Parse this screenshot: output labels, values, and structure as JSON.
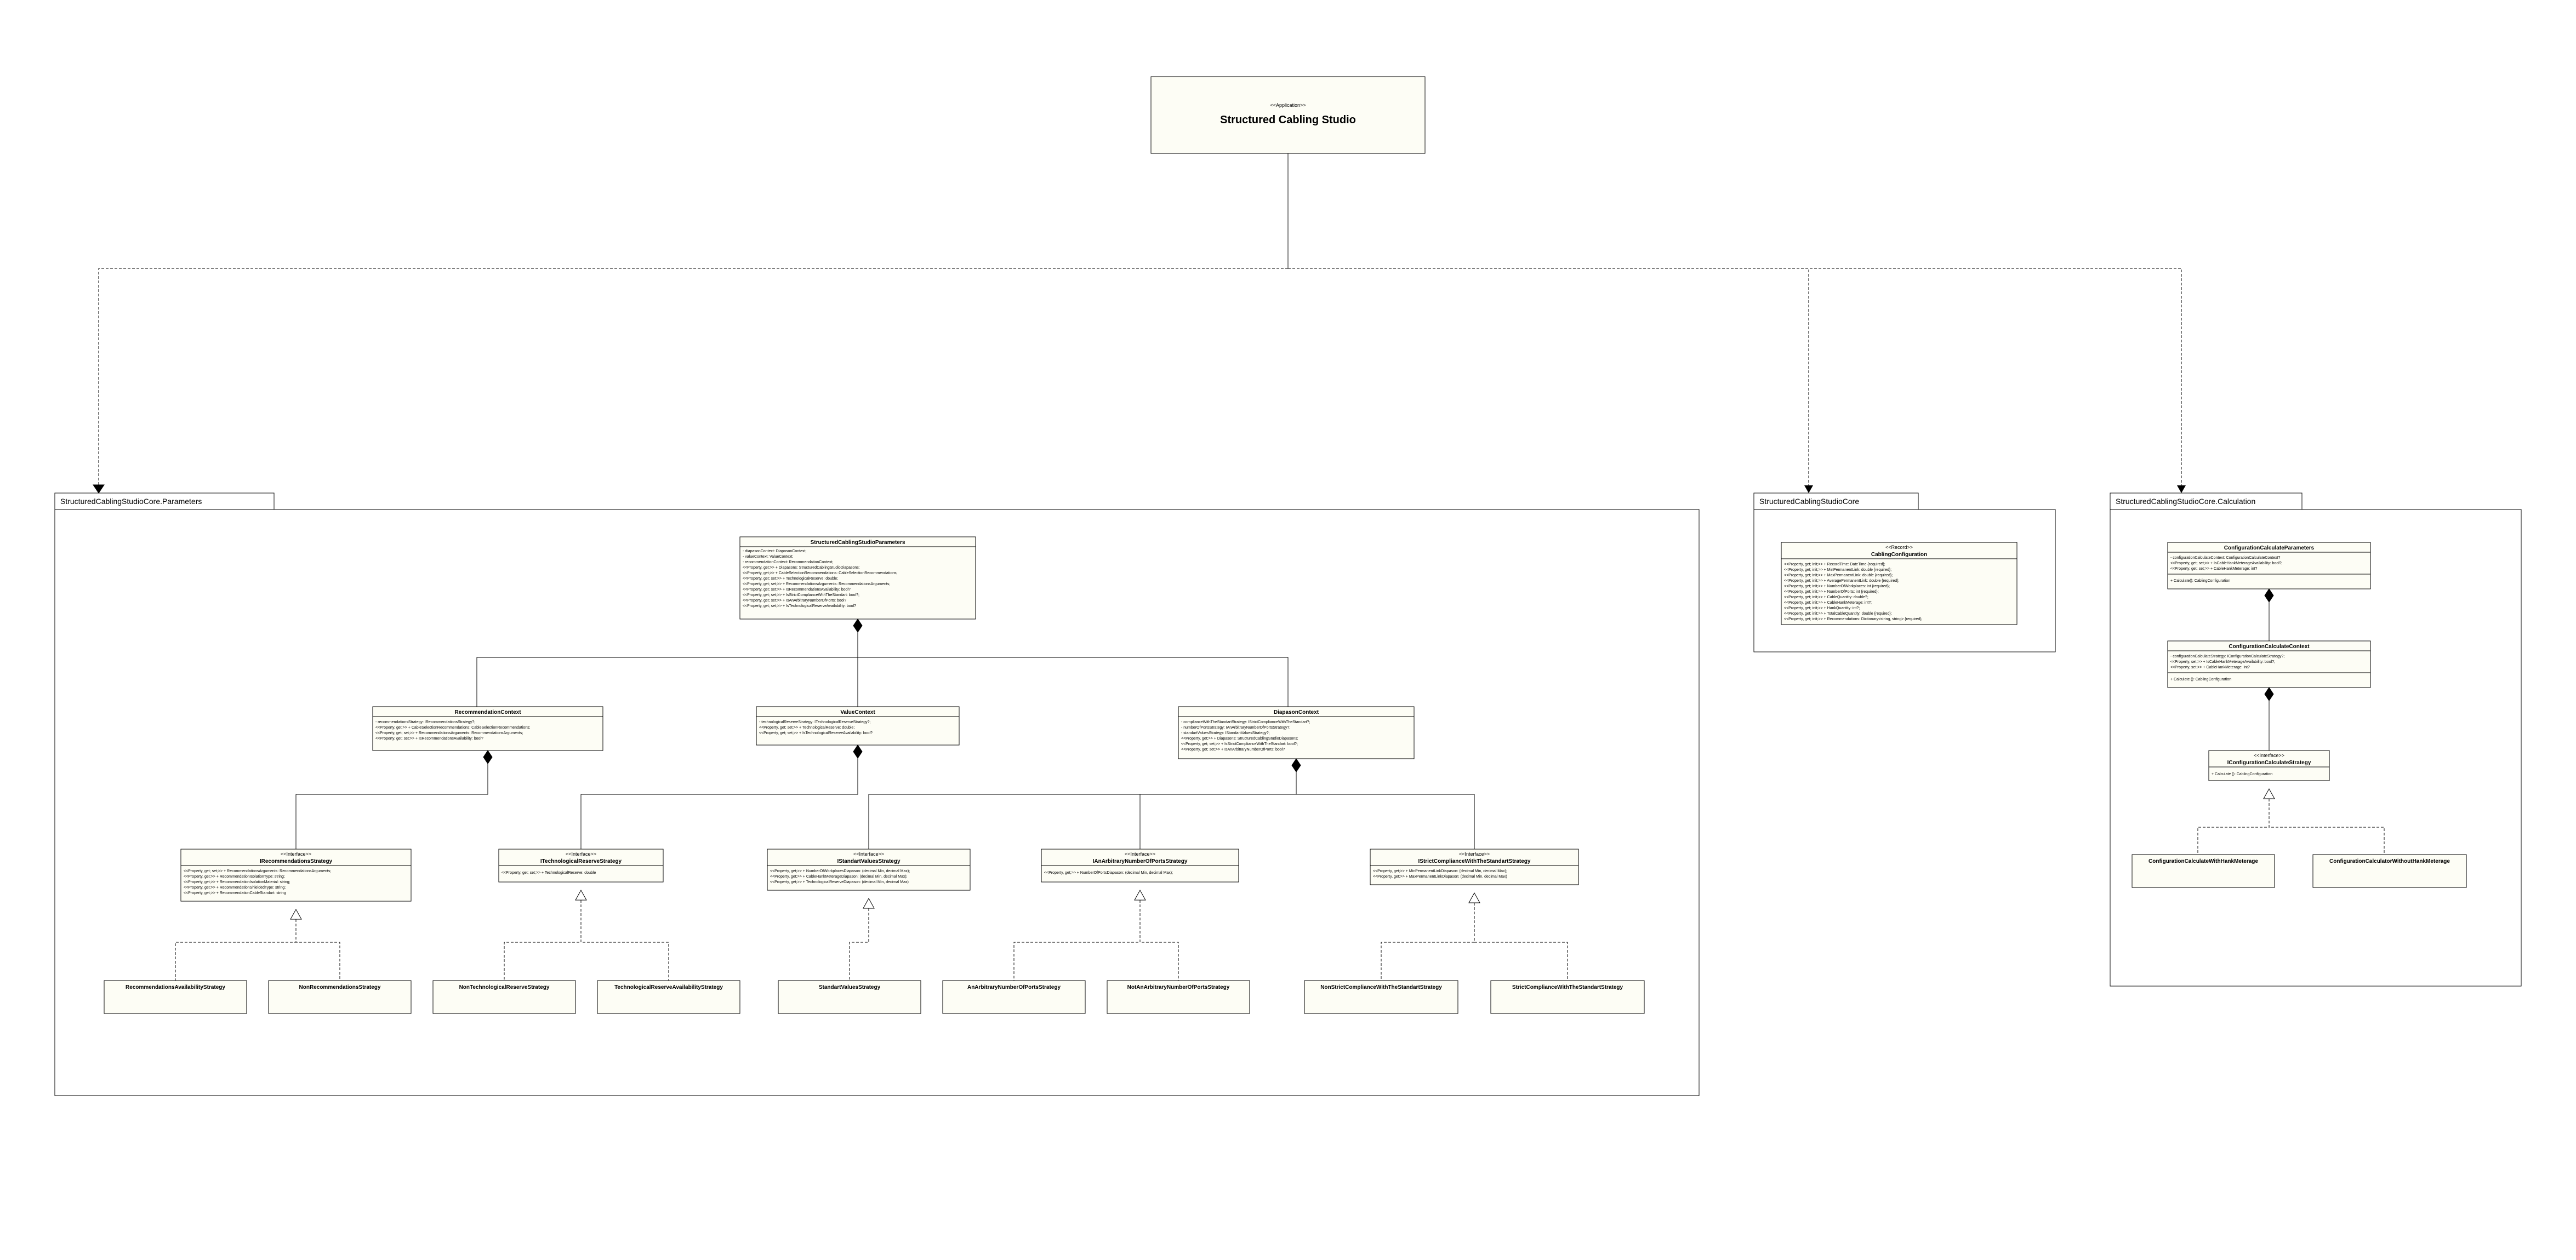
{
  "app": {
    "stereotype": "<<Application>>",
    "name": "Structured Cabling Studio"
  },
  "packages": {
    "params": "StructuredCablingStudioCore.Parameters",
    "core": "StructuredCablingStudioCore",
    "calc": "StructuredCablingStudioCore.Calculation"
  },
  "params_main": {
    "title": "StructuredCablingStudioParameters",
    "attrs": [
      "- diapasonContext: DiapasonContext;",
      "- valueContext: ValueContext;",
      "- recommendationContext: RecommendationContext;",
      "<<Property, get;>> + Diapasons: StructuredCablingStudioDiapasons;",
      "<<Property, get;>> + CableSelectionRecommendations: CableSelectionRecommendations;",
      "<<Property, get; set;>> + TechnologicalReserve: double;",
      "<<Property, get; set;>> + RecommendationsArguments: RecommendationsArguments;",
      "<<Property, get; set;>> + IsRecommendationsAvailability: bool?",
      "<<Property, get; set;>> + IsStrictComplianceWithTheStandart: bool?;",
      "<<Property, get; set;>> + IsAnArbitraryNumberOfPorts: bool?",
      "<<Property, get; set;>> + IsTechnologicalReserveAvailability: bool?"
    ]
  },
  "rec_ctx": {
    "title": "RecommendationContext",
    "attrs": [
      "- recommendationsStrategy: IRecommendationsStrategy?;",
      "<<Property, get;>> + CableSelectionRecommendations: CableSelectionRecommendations;",
      "<<Property, get; set;>> + RecommendationsArguments: RecommendationsArguments;",
      "<<Property, get; set;>> + IsRecommendationsAvailability: bool?"
    ]
  },
  "value_ctx": {
    "title": "ValueContext",
    "attrs": [
      "- technologicalReserveStrategy: ITechnologicalReserveStrategy?;",
      "<<Property, get; set;>> + TechnologicalReserve: double;",
      "<<Property, get; set;>> + IsTechnologicalReserveAvailability: bool?"
    ]
  },
  "diap_ctx": {
    "title": "DiapasonContext",
    "attrs": [
      "- complianceWithTheStandartStrategy: IStrictComplianceWithTheStandart?;",
      "- numberOfPortsStrategy: IAnArbitraryNumberOfPortsStrategy?;",
      "- standartValuesStrategy: IStandartValuesStrategy?;",
      "<<Property, get;>> + Diapasons: StructuredCablingStudioDiapasons;",
      "<<Property, get; set;>> + IsStrictComplianceWithTheStandart: bool?;",
      "<<Property, get; set;>> + IsAnArbitraryNumberOfPorts: bool?"
    ]
  },
  "irec": {
    "stereo": "<<Interface>>",
    "title": "IRecommendationsStrategy",
    "attrs": [
      "<<Property, get; set;>> + RecommendationsArguments: RecommendationsArguments;",
      "<<Property, get;>> + RecommendationIsolationType: string;",
      "<<Property, get;>> + RecommendationIsolationMaterial: string;",
      "<<Property, get;>> + RecommendationShieldedType: string;",
      "<<Property, get;>> + RecommendationCableStandart: string"
    ]
  },
  "itech": {
    "stereo": "<<Interface>>",
    "title": "ITechnologicalReserveStrategy",
    "attrs": [
      "<<Property, get; set;>> + TechnologicalReserve: double"
    ]
  },
  "istd": {
    "stereo": "<<Interface>>",
    "title": "IStandartValuesStrategy",
    "attrs": [
      "<<Property, get;>> + NumberOfWorkplacesDiapason: (decimal Min, decimal Max);",
      "<<Property, get;>> + CableHankMeterageDiapason: (decimal Min, decimal Max);",
      "<<Property, get;>> + TechnologicalReserveDiapason: (decimal Min, decimal Max)"
    ]
  },
  "iarb": {
    "stereo": "<<Interface>>",
    "title": "IAnArbitraryNumberOfPortsStrategy",
    "attrs": [
      "<<Property, get;>> + NumberOfPortsDiapason: (decimal Min, decimal Max);"
    ]
  },
  "istrict": {
    "stereo": "<<Interface>>",
    "title": "IStrictComplianceWithTheStandartStrategy",
    "attrs": [
      "<<Property, get;>> + MinPermanentLinkDiapason: (decimal Min, decimal Max);",
      "<<Property, get;>> + MaxPermanentLinkDiapason: (decimal Min, decimal Max)"
    ]
  },
  "leaves": {
    "l1": "RecommendationsAvailabilityStrategy",
    "l2": "NonRecommendationsStrategy",
    "l3": "NonTechnologicalReserveStrategy",
    "l4": "TechnologicalReserveAvailabilityStrategy",
    "l5": "StandartValuesStrategy",
    "l6": "AnArbitraryNumberOfPortsStrategy",
    "l7": "NotAnArbitraryNumberOfPortsStrategy",
    "l8": "NonStrictComplianceWithTheStandartStrategy",
    "l9": "StrictComplianceWithTheStandartStrategy"
  },
  "cabling": {
    "stereo": "<<Record>>",
    "title": "CablingConfiguration",
    "attrs": [
      "<<Property, get; init;>> + RecordTime: DateTime {required};",
      "<<Property, get; init;>> + MinPermanentLink: double {required};",
      "<<Property, get; init;>> + MaxPermanentLink: double {required};",
      "<<Property, get; init;>> + AveragePermanentLink: double {required};",
      "<<Property, get; init;>> + NumberOfWorkplaces: int {required};",
      "<<Property, get; init;>> + NumberOfPorts: int {required};",
      "<<Property, get; init;>> + CableQuantity: double?;",
      "<<Property, get; init;>> + CableHankMeterage: int?;",
      "<<Property, get; init;>> + HankQuantity: int?;",
      "<<Property, get; init;>> + TotalCableQuantity: double {required};",
      "<<Property, get; init;>> + Recommendations: Dictionary<string, string> {required};"
    ]
  },
  "calcparams": {
    "title": "ConfigurationCalculateParameters",
    "attrs": [
      "- configurationCalculateContext: ConfigurationCalculateContext?",
      "<<Property, get; set;>> + IsCableHankMeterageAvailability: bool?;",
      "<<Property, get; set;>> + CableHankMeterage: int?"
    ],
    "ops": [
      "+ Calculate(): CablingConfiguration"
    ]
  },
  "calcctx": {
    "title": "ConfigurationCalculateContext",
    "attrs": [
      "- configurationCalculateStrategy: IConfigurationCalculateStrategy?;",
      "<<Property, set;>> + IsCableHankMeterageAvailability: bool?;",
      "<<Property, set;>> + CableHankMeterage: int?"
    ],
    "ops": [
      "+ Calculate (): CablingConfiguration"
    ]
  },
  "icalc": {
    "stereo": "<<Interface>>",
    "title": "IConfigurationCalculateStrategy",
    "ops": [
      "+ Calculate (): CablingConfiguration"
    ]
  },
  "calcleaves": {
    "c1": "ConfigurationCalculateWithHankMeterage",
    "c2": "ConfigurationCalculatorWithoutHankMeterage"
  }
}
